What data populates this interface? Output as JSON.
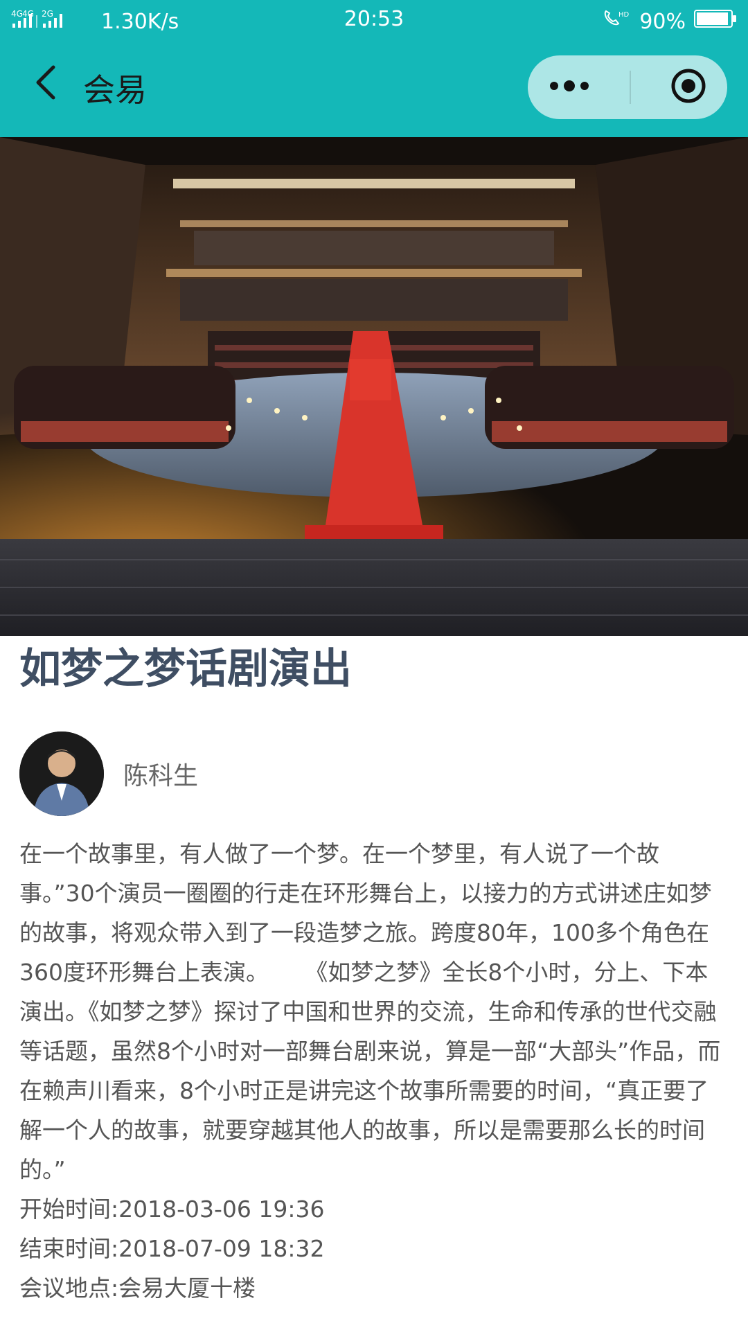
{
  "status_bar": {
    "network": "4G 4G  2G",
    "speed": "1.30K/s",
    "time": "20:53",
    "battery": "90%",
    "hd_label": "HD"
  },
  "nav": {
    "title": "会易"
  },
  "event": {
    "title": "如梦之梦话剧演出",
    "author_name": "陈科生",
    "description": "在一个故事里，有人做了一个梦。在一个梦里，有人说了一个故事。”30个演员一圈圈的行走在环形舞台上，以接力的方式讲述庄如梦的故事，将观众带入到了一段造梦之旅。跨度80年，100多个角色在360度环形舞台上表演。     《如梦之梦》全长8个小时，分上、下本演出。《如梦之梦》探讨了中国和世界的交流，生命和传承的世代交融等话题，虽然8个小时对一部舞台剧来说，算是一部“大部头”作品，而在赖声川看来，8个小时正是讲完这个故事所需要的时间，“真正要了解一个人的故事，就要穿越其他人的故事，所以是需要那么长的时间的。”",
    "start_time": "开始时间:2018-03-06 19:36",
    "end_time": "结束时间:2018-07-09 18:32",
    "location": "会议地点:会易大厦十楼"
  },
  "colors": {
    "brand": "#14b8b8",
    "title": "#3f4e63"
  }
}
